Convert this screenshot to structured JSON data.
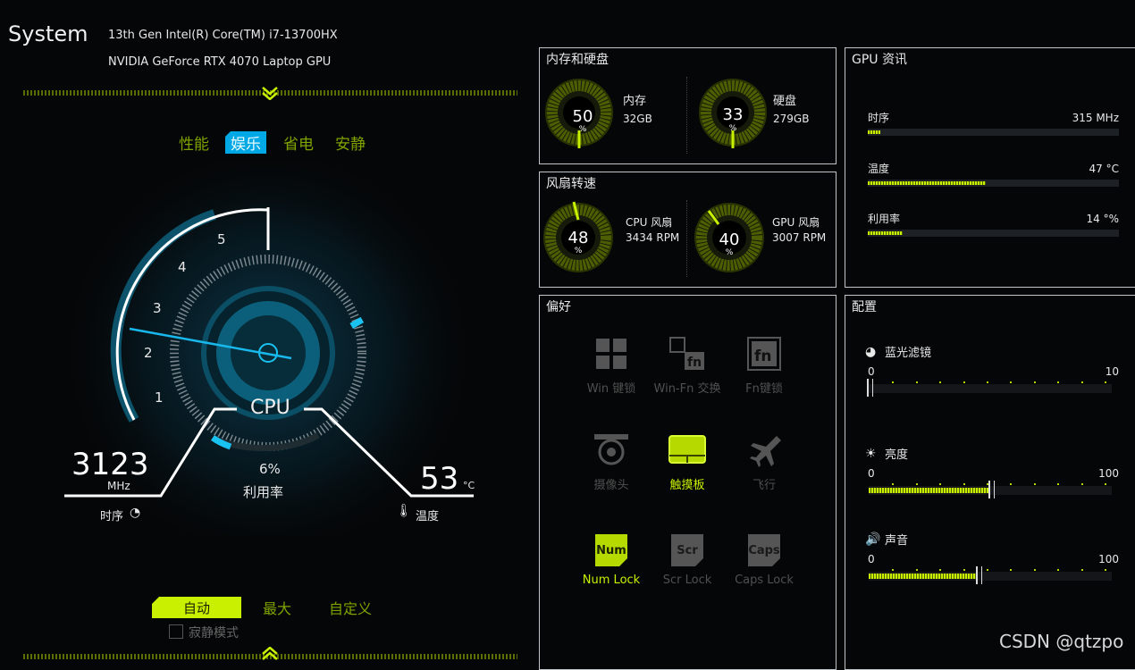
{
  "system": {
    "title": "System",
    "cpu": "13th Gen Intel(R) Core(TM) i7-13700HX",
    "gpu": "NVIDIA GeForce RTX 4070 Laptop GPU"
  },
  "modes": {
    "items": [
      "性能",
      "娱乐",
      "省电",
      "安静"
    ],
    "active": "娱乐"
  },
  "cpu_dial": {
    "scale_labels": [
      "1",
      "2",
      "3",
      "4",
      "5"
    ],
    "label": "CPU",
    "frequency": "3123",
    "frequency_unit": "MHz",
    "frequency_label": "时序",
    "usage": "6%",
    "usage_label": "利用率",
    "temperature": "53",
    "temperature_unit": "°C",
    "temperature_label": "温度"
  },
  "memory_disk": {
    "title": "内存和硬盘",
    "memory": {
      "value": "50",
      "unit": "%",
      "label": "内存",
      "size": "32GB",
      "percent": 50
    },
    "disk": {
      "value": "33",
      "unit": "%",
      "label": "硬盘",
      "size": "279GB",
      "percent": 33
    }
  },
  "fans": {
    "title": "风扇转速",
    "cpu": {
      "value": "48",
      "unit": "%",
      "label": "CPU 风扇",
      "rpm": "3434 RPM",
      "percent": 48
    },
    "gpu": {
      "value": "40",
      "unit": "%",
      "label": "GPU 风扇",
      "rpm": "3007 RPM",
      "percent": 40
    }
  },
  "gpu_info": {
    "title": "GPU 资讯",
    "rows": [
      {
        "label": "时序",
        "value": "315 MHz",
        "level": 0.05
      },
      {
        "label": "温度",
        "value": "47 °C",
        "level": 0.47
      },
      {
        "label": "利用率",
        "value": "14 °%",
        "level": 0.14
      }
    ]
  },
  "preferences": {
    "title": "偏好",
    "items": [
      {
        "label": "Win 键锁",
        "icon": "windows-icon",
        "active": false
      },
      {
        "label": "Win-Fn 交换",
        "icon": "win-fn-swap-icon",
        "active": false
      },
      {
        "label": "Fn键锁",
        "icon": "fn-lock-icon",
        "active": false
      },
      {
        "label": "摄像头",
        "icon": "camera-icon",
        "active": false
      },
      {
        "label": "触摸板",
        "icon": "touchpad-icon",
        "active": true
      },
      {
        "label": "飞行",
        "icon": "airplane-icon",
        "active": false
      },
      {
        "label": "Num Lock",
        "icon": "num-lock-icon",
        "active": true,
        "key": "Num"
      },
      {
        "label": "Scr Lock",
        "icon": "scroll-lock-icon",
        "active": false,
        "key": "Scr"
      },
      {
        "label": "Caps Lock",
        "icon": "caps-lock-icon",
        "active": false,
        "key": "Caps"
      }
    ]
  },
  "config": {
    "title": "配置",
    "sliders": [
      {
        "label": "蓝光滤镜",
        "icon": "blue-light-icon",
        "min": "0",
        "max": "10",
        "value": 0
      },
      {
        "label": "亮度",
        "icon": "brightness-icon",
        "min": "0",
        "max": "100",
        "value": 50
      },
      {
        "label": "声音",
        "icon": "speaker-icon",
        "min": "0",
        "max": "100",
        "value": 45
      }
    ]
  },
  "fan_modes": {
    "items": [
      "自动",
      "最大",
      "自定义"
    ],
    "active": "自动",
    "silent_label": "寂静模式"
  },
  "watermark": "CSDN @qtzpo",
  "colors": {
    "accent": "#c8f000",
    "cyan": "#00a9e6",
    "background": "#050607"
  }
}
